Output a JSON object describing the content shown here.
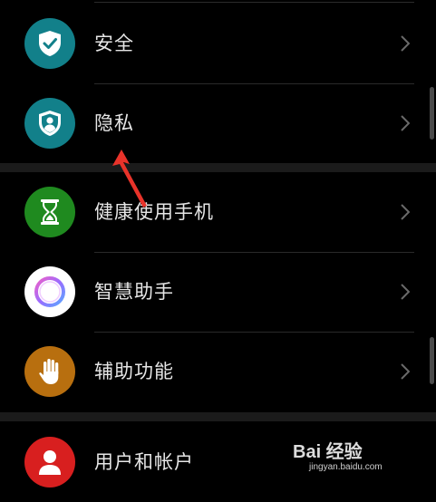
{
  "settings": {
    "items": [
      {
        "label": "安全",
        "icon": "shield-check-icon",
        "color": "#12808a"
      },
      {
        "label": "隐私",
        "icon": "privacy-shield-person-icon",
        "color": "#12808a"
      },
      {
        "label": "健康使用手机",
        "icon": "hourglass-icon",
        "color": "#1f8a1f"
      },
      {
        "label": "智慧助手",
        "icon": "assistant-ring-icon",
        "color": "#ffffff"
      },
      {
        "label": "辅助功能",
        "icon": "hand-icon",
        "color": "#b86f0f"
      },
      {
        "label": "用户和帐户",
        "icon": "user-icon",
        "color": "#d81f1f"
      }
    ]
  },
  "annotation": {
    "arrow_color": "#e8332a"
  },
  "watermark": {
    "main": "Bai 经验",
    "sub": "jingyan.baidu.com"
  }
}
